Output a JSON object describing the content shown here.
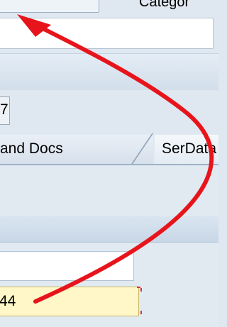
{
  "header": {
    "category_label": "Categor"
  },
  "small_field": {
    "value": "7"
  },
  "tabs": [
    {
      "label": "and Docs"
    },
    {
      "label": "SerData"
    }
  ],
  "form": {
    "field2_value": "44"
  },
  "annotation": {
    "arrow_color": "#e8141b"
  },
  "colors": {
    "background": "#dfe8f1",
    "required_input": "#fff7c8"
  }
}
